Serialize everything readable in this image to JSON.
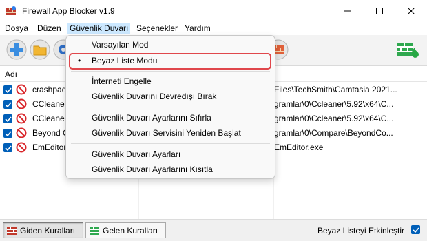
{
  "window": {
    "title": "Firewall App Blocker v1.9"
  },
  "menubar": {
    "items": [
      "Dosya",
      "Düzen",
      "Güvenlik Duvarı",
      "Seçenekler",
      "Yardım"
    ]
  },
  "dropdown": {
    "items": [
      "Varsayılan Mod",
      "Beyaz Liste Modu",
      "İnterneti Engelle",
      "Güvenlik Duvarını Devredışı Bırak",
      "Güvenlik Duvarı Ayarlarını Sıfırla",
      "Güvenlik Duvarı Servisini Yeniden Başlat",
      "Güvenlik Duvarı Ayarları",
      "Güvenlik Duvarı Ayarlarını Kısıtla"
    ],
    "selected_bullet": "•"
  },
  "list": {
    "column_name": "Adı",
    "rows": [
      {
        "name": "crashpad",
        "path": "Files\\TechSmith\\Camtasia 2021..."
      },
      {
        "name": "CCleaner",
        "path": "gramlar\\0\\Ccleaner\\5.92\\x64\\C..."
      },
      {
        "name": "CCleaner",
        "path": "gramlar\\0\\Ccleaner\\5.92\\x64\\C..."
      },
      {
        "name": "Beyond C",
        "path": "gramlar\\0\\Compare\\BeyondCo..."
      },
      {
        "name": "EmEditor",
        "path": "EmEditor.exe"
      }
    ]
  },
  "statusbar": {
    "outgoing_label": "Giden Kuralları",
    "incoming_label": "Gelen Kuralları",
    "whitelist_label": "Beyaz Listeyi Etkinleştir"
  },
  "icons": {
    "app": "firewall-app-icon",
    "add": "add-icon",
    "folder": "folder-icon",
    "settings": "gear-icon",
    "firewall": "firewall-icon",
    "whitelist_toggle": "firewall-green-icon"
  },
  "colors": {
    "accent": "#005fb8",
    "highlight": "#e0474c",
    "ban": "#d9262b"
  }
}
